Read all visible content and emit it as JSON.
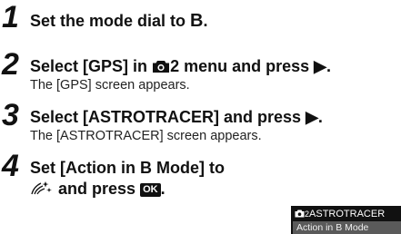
{
  "steps": [
    {
      "number": "1",
      "heading_pre": "Set the mode dial to",
      "heading_mode": "B",
      "heading_post": "."
    },
    {
      "number": "2",
      "heading_pre": "Select [GPS] in",
      "heading_menu_num": "2",
      "heading_post": "menu and press",
      "arrow": "▶",
      "heading_end": ".",
      "note": "The [GPS] screen appears."
    },
    {
      "number": "3",
      "heading_pre": "Select [ASTROTRACER] and press",
      "arrow": "▶",
      "heading_end": ".",
      "note": "The [ASTROTRACER] screen appears."
    },
    {
      "number": "4",
      "line1": "Set [Action in B Mode] to",
      "line2_post": "and press",
      "ok_label": "OK",
      "line2_end": "."
    }
  ],
  "camera_screen": {
    "title_num": "2",
    "title": "ASTROTRACER",
    "row": "Action in B Mode"
  },
  "icons": [
    "camera-menu-icon",
    "astrotracer-icon",
    "ok-button-icon",
    "right-arrow-icon"
  ],
  "colors": {
    "text": "#111111",
    "screen_bg": "#111111",
    "row_highlight": "#5a5a5a"
  }
}
